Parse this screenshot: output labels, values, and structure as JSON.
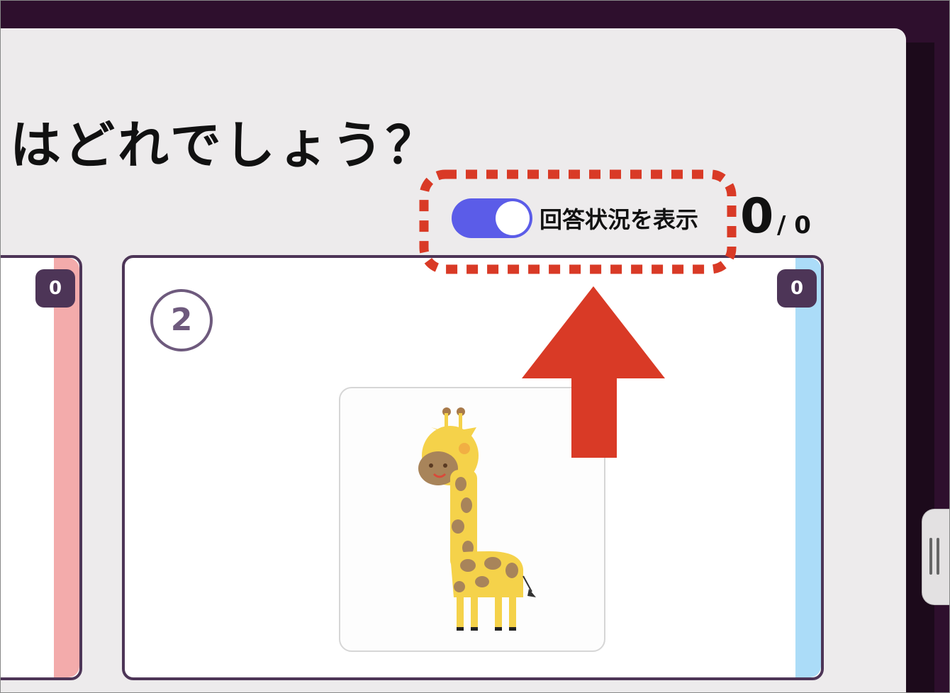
{
  "question": {
    "text": "はどれでしょう？"
  },
  "toggle": {
    "label": "回答状況を表示",
    "on": true,
    "color": "#5b5ce8"
  },
  "answer_count": {
    "answered": "0",
    "total": "/ 0"
  },
  "cards": [
    {
      "badge": "0",
      "stripe_color": "#f3abab"
    },
    {
      "number": "2",
      "badge": "0",
      "stripe_color": "#abdcf8",
      "image": "giraffe-illustration"
    }
  ],
  "annotation": {
    "highlight_color": "#d93a26",
    "arrow": "up-arrow-icon"
  },
  "side_handle": {
    "icon": "grip-handle-icon"
  }
}
